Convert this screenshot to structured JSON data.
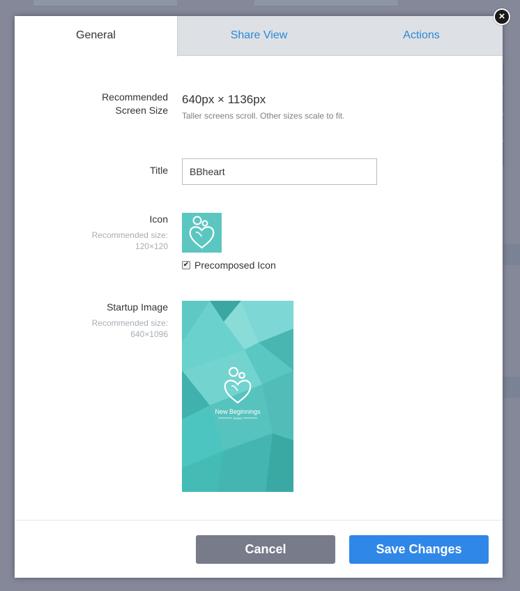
{
  "tabs": [
    {
      "label": "General"
    },
    {
      "label": "Share View"
    },
    {
      "label": "Actions"
    }
  ],
  "close": {
    "glyph": "×"
  },
  "general": {
    "screen_size_label": "Recommended Screen Size",
    "screen_size_label_line1": "Recommended",
    "screen_size_label_line2": "Screen Size",
    "screen_size_value": "640px × 1136px",
    "screen_size_hint": "Taller screens scroll. Other sizes scale to fit.",
    "title_label": "Title",
    "title_value": "BBheart",
    "icon_label": "Icon",
    "icon_recommended_line1": "Recommended size:",
    "icon_recommended_line2": "120×120",
    "precomposed_label": "Precomposed Icon",
    "precomposed_checked": true,
    "startup_label": "Startup Image",
    "startup_recommended_line1": "Recommended size:",
    "startup_recommended_line2": "640×1096",
    "startup_brand": "New Beginnings",
    "startup_brand_sub": "homes"
  },
  "footer": {
    "cancel_label": "Cancel",
    "save_label": "Save Changes"
  },
  "colors": {
    "accent": "#2f87e8",
    "cancel": "#777b8a",
    "icon_teal": "#5cc6c1"
  }
}
